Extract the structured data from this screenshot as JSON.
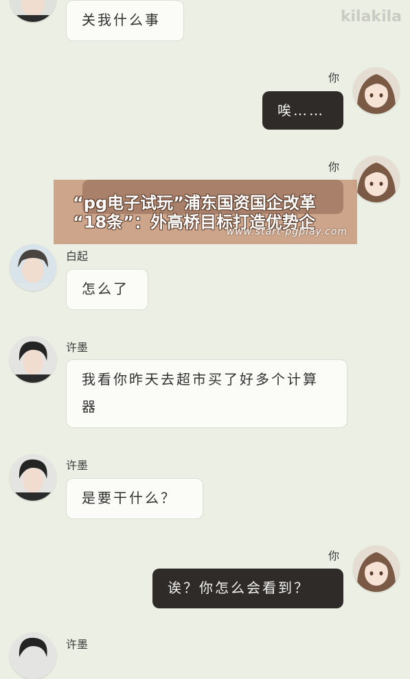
{
  "app": {
    "watermark": "kilakila"
  },
  "banner": {
    "line1": "“pg电子试玩”浦东国资国企改革",
    "line2": "“18条”：外高桥目标打造优势企",
    "url": "www.start-pgplay.com"
  },
  "messages": [
    {
      "side": "left",
      "sender": "",
      "text": "关我什么事"
    },
    {
      "side": "right",
      "sender": "你",
      "text": "唉……"
    },
    {
      "side": "right",
      "sender": "你",
      "text": ""
    },
    {
      "side": "left",
      "sender": "白起",
      "text": "怎么了"
    },
    {
      "side": "left",
      "sender": "许墨",
      "text": "我看你昨天去超市买了好多个计算器"
    },
    {
      "side": "left",
      "sender": "许墨",
      "text": "是要干什么？"
    },
    {
      "side": "right",
      "sender": "你",
      "text": "诶？你怎么会看到？"
    },
    {
      "side": "left",
      "sender": "许墨",
      "text": ""
    }
  ],
  "colors": {
    "background": "#ecf0e4",
    "left_bubble": "#fbfbf8",
    "right_bubble": "#2f2b28",
    "banner": "#c49478"
  },
  "icons": {
    "user_avatar": "girl-avatar-icon",
    "baiqi_avatar": "baiqi-avatar-icon",
    "xumo_avatar": "xumo-avatar-icon"
  }
}
